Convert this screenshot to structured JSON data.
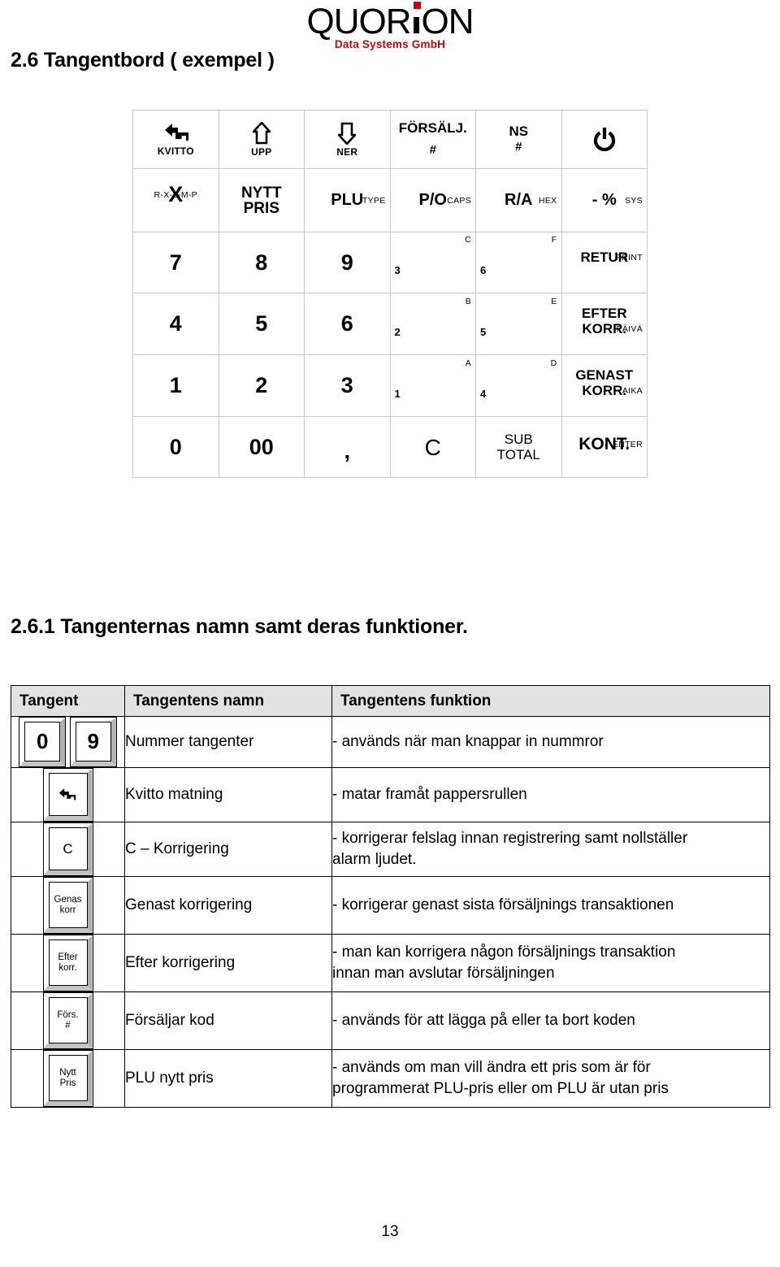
{
  "logo": {
    "word_pre": "QUOR",
    "word_post": "ON",
    "subtitle": "Data Systems GmbH",
    "dot_color": "#c00010",
    "subtitle_color": "#b50a17"
  },
  "headings": {
    "section_26": "2.6 Tangentbord ( exempel )",
    "section_261": "2.6.1 Tangenternas namn samt deras funktioner."
  },
  "keyboard": {
    "rows": [
      [
        {
          "icon": "receipt-feed-icon",
          "label": "KVITTO"
        },
        {
          "icon": "arrow-up-icon",
          "label": "UPP"
        },
        {
          "icon": "arrow-down-icon",
          "label": "NER"
        },
        {
          "main": "FÖRSÄLJ.",
          "sub_center": "#"
        },
        {
          "main": "NS",
          "sub_center": "#"
        },
        {
          "icon": "power-icon",
          "label": ""
        }
      ],
      [
        {
          "main": "X",
          "bottom_center": "R-X-Z-M-P"
        },
        {
          "main": "NYTT",
          "main2": "PRIS"
        },
        {
          "main": "PLU",
          "bottom_right": "TYPE"
        },
        {
          "main": "P/O",
          "bottom_right": "CAPS"
        },
        {
          "main": "R/A",
          "bottom_right": "HEX"
        },
        {
          "main": "- %",
          "bottom_right": "SYS"
        }
      ],
      [
        {
          "main": "7"
        },
        {
          "main": "8"
        },
        {
          "main": "9"
        },
        {
          "top_left": "3",
          "bottom_right": "C"
        },
        {
          "top_left": "6",
          "bottom_right": "F"
        },
        {
          "main": "RETUR",
          "bottom_right": "PRINT"
        }
      ],
      [
        {
          "main": "4"
        },
        {
          "main": "5"
        },
        {
          "main": "6"
        },
        {
          "top_left": "2",
          "bottom_right": "B"
        },
        {
          "top_left": "5",
          "bottom_right": "E"
        },
        {
          "main": "EFTER",
          "main2": "KORR.",
          "bottom_right": "PÄIVÄ"
        }
      ],
      [
        {
          "main": "1"
        },
        {
          "main": "2"
        },
        {
          "main": "3"
        },
        {
          "top_left": "1",
          "bottom_right": "A"
        },
        {
          "top_left": "4",
          "bottom_right": "D"
        },
        {
          "main": "GENAST",
          "main2": "KORR.",
          "bottom_right": "AIKA"
        }
      ],
      [
        {
          "main": "0"
        },
        {
          "main": "00"
        },
        {
          "main": ","
        },
        {
          "main": "C"
        },
        {
          "main": "SUB",
          "main2": "TOTAL",
          "plain": true
        },
        {
          "main": "KONT.",
          "bottom_right": "ENTER"
        }
      ]
    ]
  },
  "table": {
    "headers": [
      "Tangent",
      "Tangentens namn",
      "Tangentens funktion"
    ],
    "rows": [
      {
        "keys": [
          {
            "type": "num",
            "lines": [
              "0"
            ]
          },
          {
            "type": "num",
            "lines": [
              "9"
            ]
          }
        ],
        "name": "Nummer tangenter",
        "function": [
          "- används när man knappar in nummror"
        ]
      },
      {
        "keys": [
          {
            "type": "icon",
            "icon": "receipt-feed-icon",
            "lines": []
          }
        ],
        "name": "Kvitto matning",
        "function": [
          "- matar framåt pappersrullen"
        ]
      },
      {
        "keys": [
          {
            "type": "std",
            "lines": [
              "C"
            ]
          }
        ],
        "name": "C – Korrigering",
        "function": [
          "- korrigerar felslag innan registrering samt nollställer",
          "alarm ljudet."
        ]
      },
      {
        "keys": [
          {
            "type": "sm",
            "lines": [
              "Genas",
              "korr"
            ]
          }
        ],
        "name": "Genast korrigering",
        "function": [
          "- korrigerar genast sista försäljnings transaktionen"
        ]
      },
      {
        "keys": [
          {
            "type": "sm",
            "lines": [
              "Efter",
              "korr."
            ]
          }
        ],
        "name": "Efter korrigering",
        "function": [
          "- man kan korrigera någon försäljnings transaktion",
          "innan man avslutar försäljningen"
        ]
      },
      {
        "keys": [
          {
            "type": "sm",
            "lines": [
              "Förs.",
              "#"
            ]
          }
        ],
        "name": "Försäljar kod",
        "function": [
          "- används för att lägga på eller ta bort koden"
        ]
      },
      {
        "keys": [
          {
            "type": "sm",
            "lines": [
              "Nytt",
              "Pris"
            ]
          }
        ],
        "name": "PLU nytt pris",
        "function": [
          "- används om man vill ändra ett pris som är för",
          "programmerat  PLU-pris eller om PLU är utan pris"
        ]
      }
    ]
  },
  "footer": {
    "page_number": "13"
  }
}
